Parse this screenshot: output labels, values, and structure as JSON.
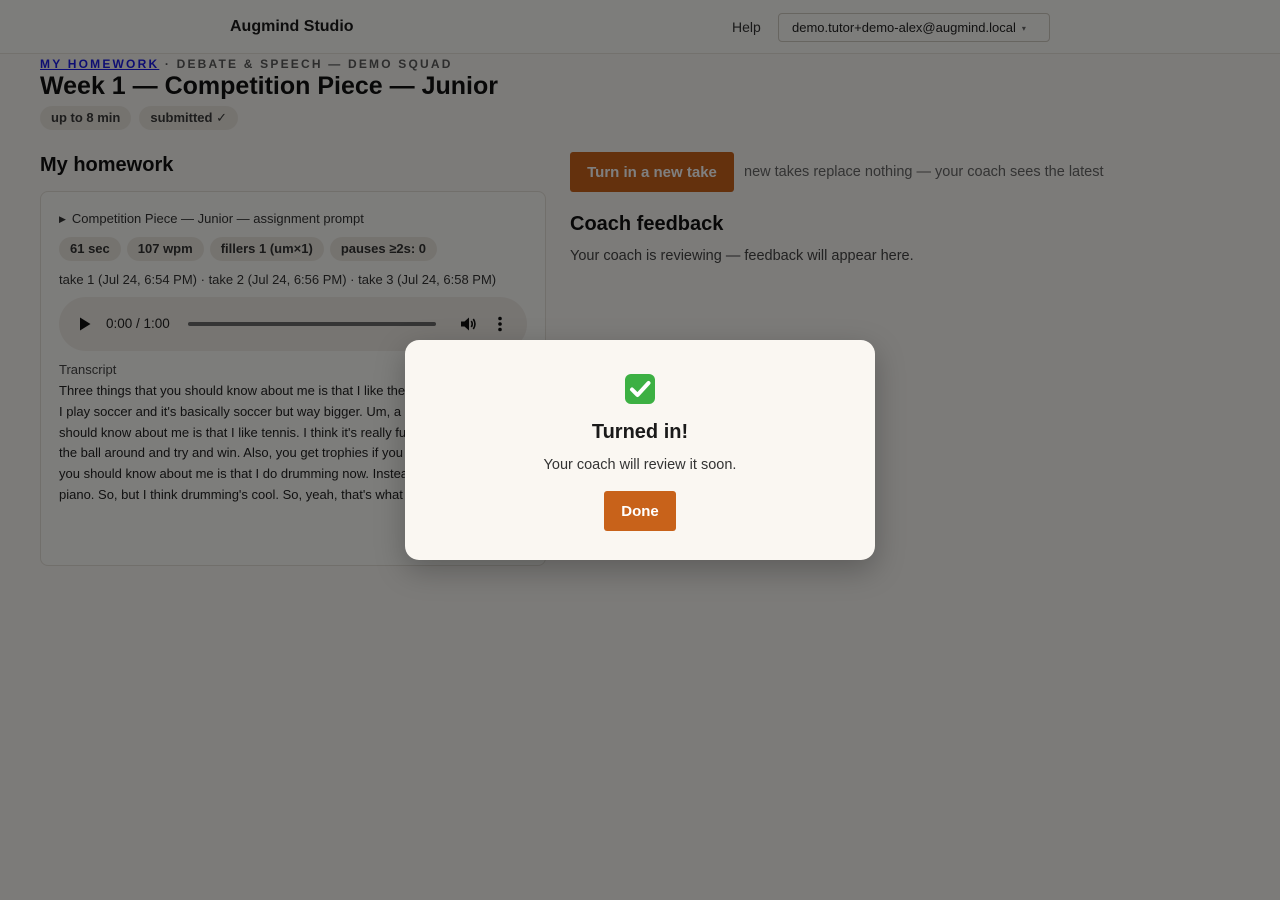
{
  "header": {
    "brand": "Augmind Studio",
    "help_label": "Help",
    "account_email": "demo.tutor+demo-alex@augmind.local"
  },
  "breadcrumb": {
    "link": "My homework",
    "separator": " · ",
    "group": "Debate & Speech — Demo Squad"
  },
  "assignment": {
    "title": "Week 1 — Competition Piece — Junior",
    "chips": [
      "up to 8 min",
      "submitted ✓"
    ]
  },
  "my_homework": {
    "heading": "My homework",
    "prompt_toggle": "Competition Piece — Junior — assignment prompt",
    "metrics": [
      "61 sec",
      "107 wpm",
      "fillers 1 (um×1)",
      "pauses ≥2s: 0"
    ],
    "takes": "take 1 (Jul 24, 6:54 PM) · take 2 (Jul 24, 6:56 PM) · take 3 (Jul 24, 6:58 PM)",
    "audio": {
      "time": "0:00 / 1:00",
      "progress": 0
    },
    "transcript_label": "Transcript",
    "transcript": "Three things that you should know about me is that I like the World Cup because I play soccer and it's basically soccer but way bigger. Um, a second thing that you should know about me is that I like tennis. I think it's really fun because you hit the ball around and try and win. Also, you get trophies if you win. The last thing you should know about me is that I do drumming now. Instead of piano I quit piano. So, but I think drumming's cool. So, yeah, that's what my three things."
  },
  "actions": {
    "new_take_label": "Turn in a new take",
    "new_take_note": "new takes replace nothing — your coach sees the latest"
  },
  "feedback": {
    "heading": "Coach feedback",
    "status": "Your coach is reviewing — feedback will appear here."
  },
  "modal": {
    "icon": "check-mark-button-icon",
    "title": "Turned in!",
    "message": "Your coach will review it soon.",
    "done_label": "Done"
  },
  "colors": {
    "accent": "#c8621a",
    "link": "#1a1ae6",
    "background": "#f8f6f2",
    "success": "#3cb043"
  }
}
